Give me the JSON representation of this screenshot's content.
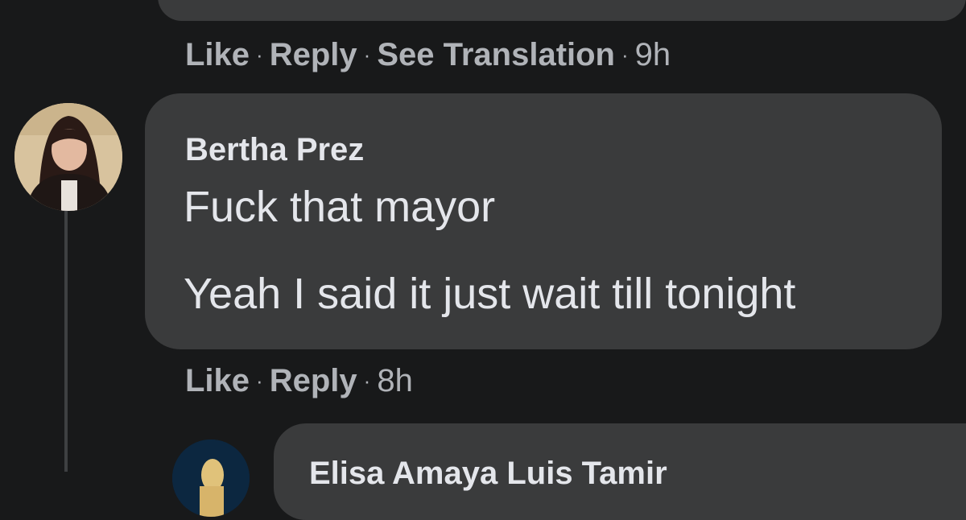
{
  "previous_comment": {
    "actions": {
      "like": "Like",
      "reply": "Reply",
      "see_translation": "See Translation",
      "time": "9h"
    }
  },
  "comment": {
    "author": "Bertha Prez",
    "lines": [
      "Fuck that mayor",
      "Yeah I said it just wait till tonight"
    ],
    "actions": {
      "like": "Like",
      "reply": "Reply",
      "time": "8h"
    }
  },
  "reply": {
    "author": "Elisa Amaya Luis Tamir"
  },
  "colors": {
    "background": "#18191a",
    "bubble": "#3a3b3c",
    "primary_text": "#e4e6eb",
    "secondary_text": "#b0b3b8"
  }
}
